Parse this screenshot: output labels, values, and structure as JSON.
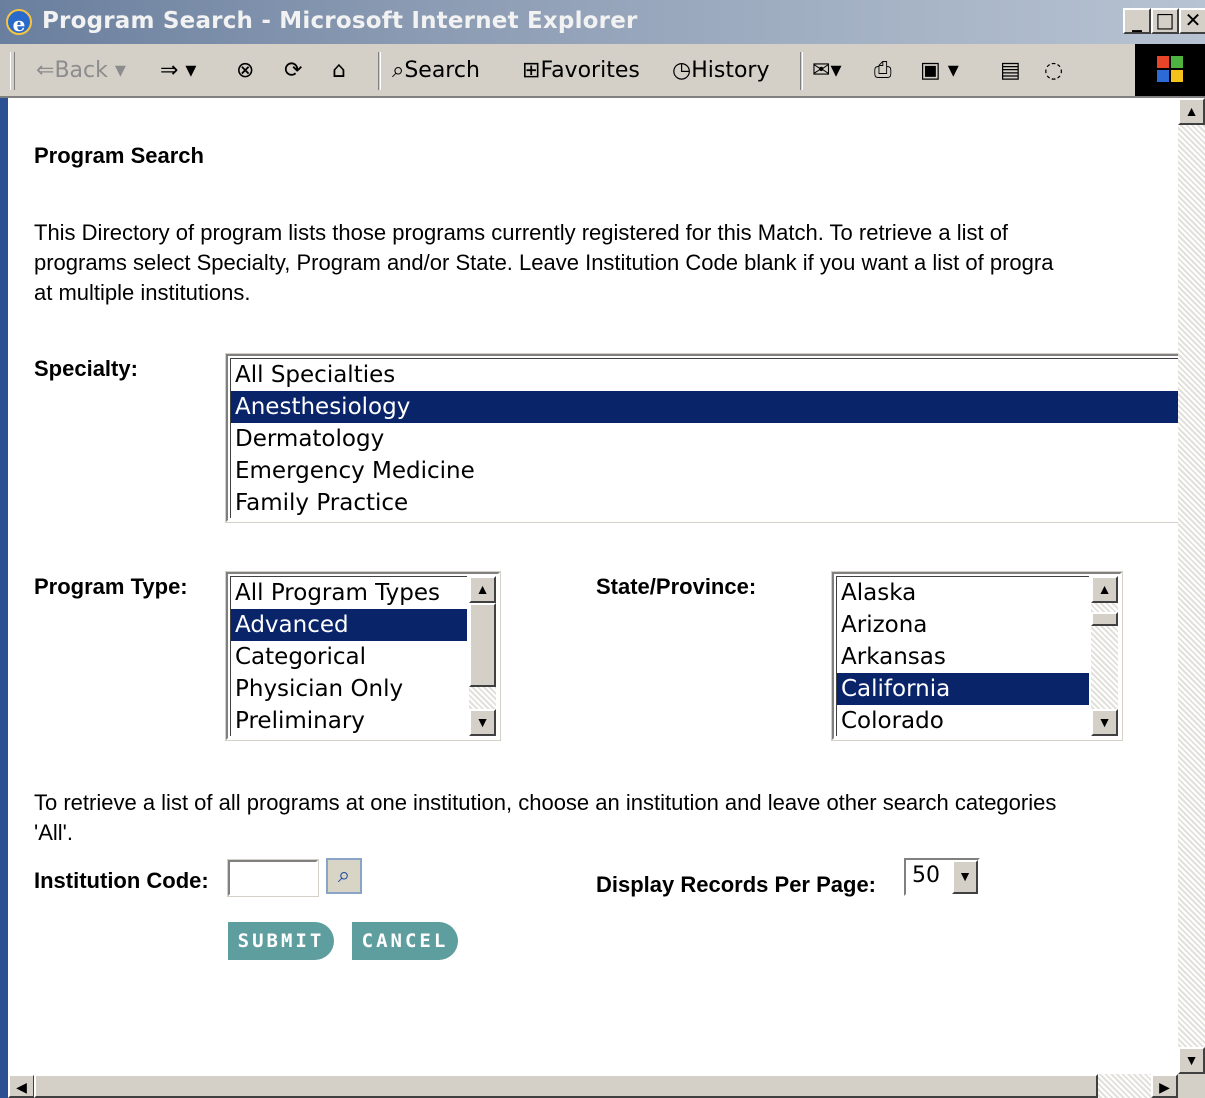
{
  "window": {
    "title": "Program Search - Microsoft Internet Explorer"
  },
  "toolbar": {
    "back": "Back",
    "search": "Search",
    "favorites": "Favorites",
    "history": "History"
  },
  "page": {
    "heading": "Program Search",
    "intro": "This Directory of program lists those programs currently registered for this Match. To retrieve a list of\nprograms select Specialty, Program and/or State.  Leave Institution Code blank if you want a list of progra\nat multiple institutions.",
    "specialty_label": "Specialty:",
    "specialties": [
      "All Specialties",
      "Anesthesiology",
      "Dermatology",
      "Emergency Medicine",
      "Family Practice"
    ],
    "specialty_selected": "Anesthesiology",
    "program_type_label": "Program Type:",
    "program_types": [
      "All Program Types",
      "Advanced",
      "Categorical",
      "Physician Only",
      "Preliminary"
    ],
    "program_type_selected": "Advanced",
    "state_label": "State/Province:",
    "states": [
      "Alaska",
      "Arizona",
      "Arkansas",
      "California",
      "Colorado"
    ],
    "state_selected": "California",
    "institution_help": "To retrieve a list of all programs at one institution, choose an institution and leave other search categories\n'All'.",
    "institution_code_label": "Institution Code:",
    "institution_code_value": "",
    "records_per_page_label": "Display Records Per Page:",
    "records_per_page_value": "50",
    "submit_label": "SUBMIT",
    "cancel_label": "CANCEL"
  },
  "colors": {
    "selection": "#0a246a",
    "button_teal": "#5f9e9e",
    "title_bar": "#8b9bb3"
  }
}
